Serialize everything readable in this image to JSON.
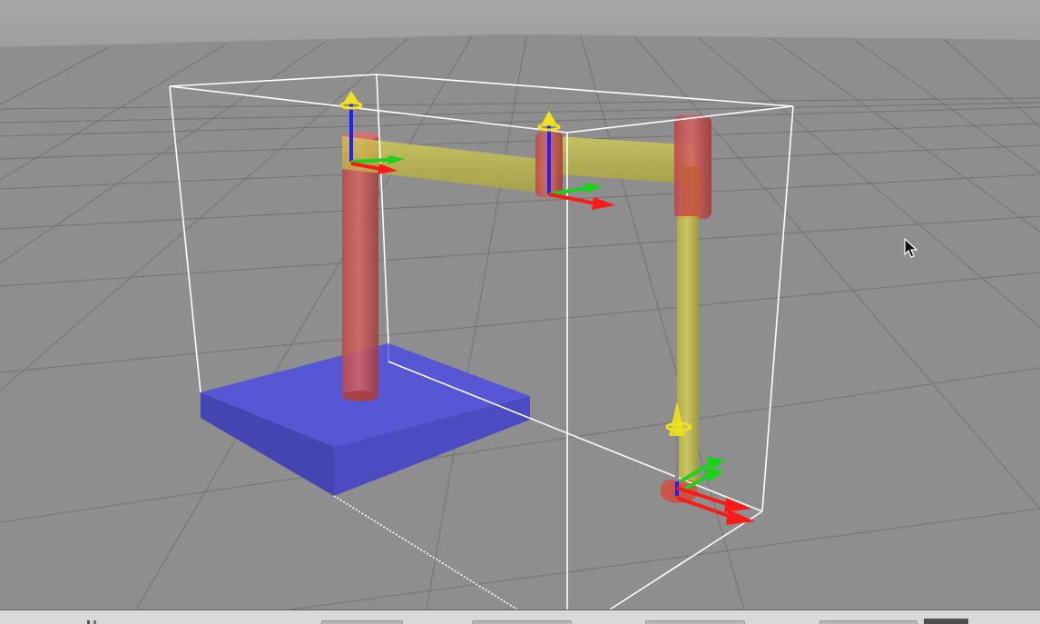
{
  "viewport": {
    "colors": {
      "sky": "#a8a8a8",
      "ground": "#8e8e8e",
      "grid_line": "#6f6f6f",
      "bounding_box": "#ffffff",
      "base_link": "#4a4ad6",
      "red_link": "#c84c4c",
      "yellow_link": "#c8c24a",
      "axis_x": "#ff1a1a",
      "axis_y": "#1ad21a",
      "axis_z": "#1a1aff",
      "joint_marker": "#f0e020"
    },
    "scene_objects": [
      "ground-grid",
      "bounding-box",
      "base-plate",
      "link-vertical-pillar",
      "link-horizontal-arm",
      "link-vertical-arm",
      "joint-frames"
    ]
  },
  "status_bar": {
    "segments": [
      "",
      "",
      "",
      "",
      "",
      ""
    ]
  },
  "cursor": {
    "icon": "mouse-pointer-icon"
  }
}
